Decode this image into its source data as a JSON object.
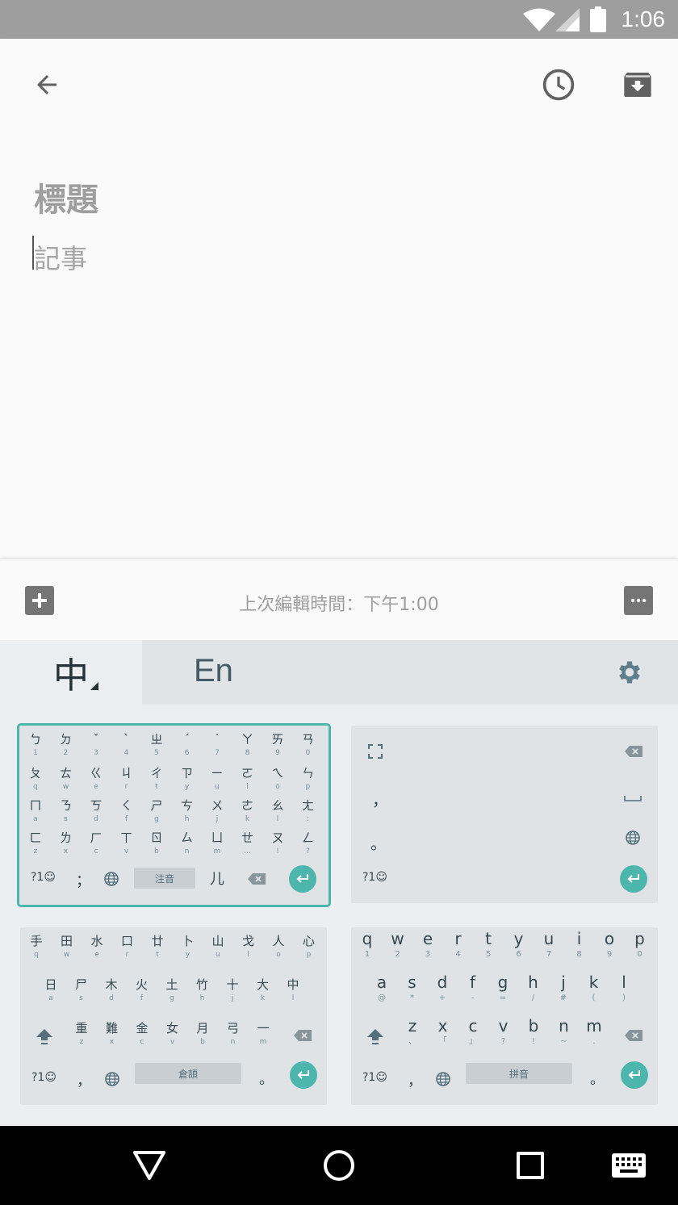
{
  "status": {
    "time": "1:06"
  },
  "note": {
    "title_placeholder": "標題",
    "body_placeholder": "記事"
  },
  "bottom": {
    "edited": "上次編輯時間：下午1:00"
  },
  "keyboard": {
    "lang_zh": "中",
    "lang_en": "En",
    "zhuyin": {
      "rows": [
        [
          [
            "ㄅ",
            "1"
          ],
          [
            "ㄉ",
            "2"
          ],
          [
            "ˇ",
            "3"
          ],
          [
            "ˋ",
            "4"
          ],
          [
            "ㄓ",
            "5"
          ],
          [
            "ˊ",
            "6"
          ],
          [
            "˙",
            "7"
          ],
          [
            "ㄚ",
            "8"
          ],
          [
            "ㄞ",
            "9"
          ],
          [
            "ㄢ",
            "0"
          ]
        ],
        [
          [
            "ㄆ",
            "q"
          ],
          [
            "ㄊ",
            "w"
          ],
          [
            "ㄍ",
            "e"
          ],
          [
            "ㄐ",
            "r"
          ],
          [
            "ㄔ",
            "t"
          ],
          [
            "ㄗ",
            "y"
          ],
          [
            "ㄧ",
            "u"
          ],
          [
            "ㄛ",
            "i"
          ],
          [
            "ㄟ",
            "o"
          ],
          [
            "ㄣ",
            "p"
          ]
        ],
        [
          [
            "ㄇ",
            "a"
          ],
          [
            "ㄋ",
            "s"
          ],
          [
            "ㄎ",
            "d"
          ],
          [
            "ㄑ",
            "f"
          ],
          [
            "ㄕ",
            "g"
          ],
          [
            "ㄘ",
            "h"
          ],
          [
            "ㄨ",
            "j"
          ],
          [
            "ㄜ",
            "k"
          ],
          [
            "ㄠ",
            "l"
          ],
          [
            "ㄤ",
            ":"
          ]
        ],
        [
          [
            "ㄈ",
            "z"
          ],
          [
            "ㄌ",
            "x"
          ],
          [
            "ㄏ",
            "c"
          ],
          [
            "ㄒ",
            "v"
          ],
          [
            "ㄖ",
            "b"
          ],
          [
            "ㄙ",
            "n"
          ],
          [
            "ㄩ",
            "m"
          ],
          [
            "ㄝ",
            "…"
          ],
          [
            "ㄡ",
            "!"
          ],
          [
            "ㄥ",
            "?"
          ]
        ]
      ],
      "symbols": "?1☺",
      "punct": "；",
      "space": "注音",
      "er": "儿"
    },
    "handwriting": {
      "comma": "，",
      "period": "。",
      "symbols": "?1☺"
    },
    "cangjie": {
      "row1": [
        [
          "手",
          "q"
        ],
        [
          "田",
          "w"
        ],
        [
          "水",
          "e"
        ],
        [
          "口",
          "r"
        ],
        [
          "廿",
          "t"
        ],
        [
          "卜",
          "y"
        ],
        [
          "山",
          "u"
        ],
        [
          "戈",
          "i"
        ],
        [
          "人",
          "o"
        ],
        [
          "心",
          "p"
        ]
      ],
      "row2": [
        [
          "日",
          "a"
        ],
        [
          "尸",
          "s"
        ],
        [
          "木",
          "d"
        ],
        [
          "火",
          "f"
        ],
        [
          "土",
          "g"
        ],
        [
          "竹",
          "h"
        ],
        [
          "十",
          "j"
        ],
        [
          "大",
          "k"
        ],
        [
          "中",
          "l"
        ]
      ],
      "row3": [
        [
          "重",
          "z"
        ],
        [
          "難",
          "x"
        ],
        [
          "金",
          "c"
        ],
        [
          "女",
          "v"
        ],
        [
          "月",
          "b"
        ],
        [
          "弓",
          "n"
        ],
        [
          "一",
          "m"
        ]
      ],
      "symbols": "?1☺",
      "comma": "，",
      "space": "倉頡",
      "period": "。"
    },
    "pinyin": {
      "row1": [
        [
          "q",
          "1"
        ],
        [
          "w",
          "2"
        ],
        [
          "e",
          "3"
        ],
        [
          "r",
          "4"
        ],
        [
          "t",
          "5"
        ],
        [
          "y",
          "6"
        ],
        [
          "u",
          "7"
        ],
        [
          "i",
          "8"
        ],
        [
          "o",
          "9"
        ],
        [
          "p",
          "0"
        ]
      ],
      "row2": [
        [
          "a",
          "@"
        ],
        [
          "s",
          "*"
        ],
        [
          "d",
          "+"
        ],
        [
          "f",
          "-"
        ],
        [
          "g",
          "="
        ],
        [
          "h",
          "/"
        ],
        [
          "j",
          "#"
        ],
        [
          "k",
          "("
        ],
        [
          "l",
          ")"
        ]
      ],
      "row3": [
        [
          "z",
          "、"
        ],
        [
          "x",
          "「"
        ],
        [
          "c",
          "」"
        ],
        [
          "v",
          "?"
        ],
        [
          "b",
          "!"
        ],
        [
          "n",
          "~"
        ],
        [
          "m",
          "."
        ]
      ],
      "symbols": "?1☺",
      "comma": "，",
      "space": "拼音",
      "period": "。"
    }
  }
}
